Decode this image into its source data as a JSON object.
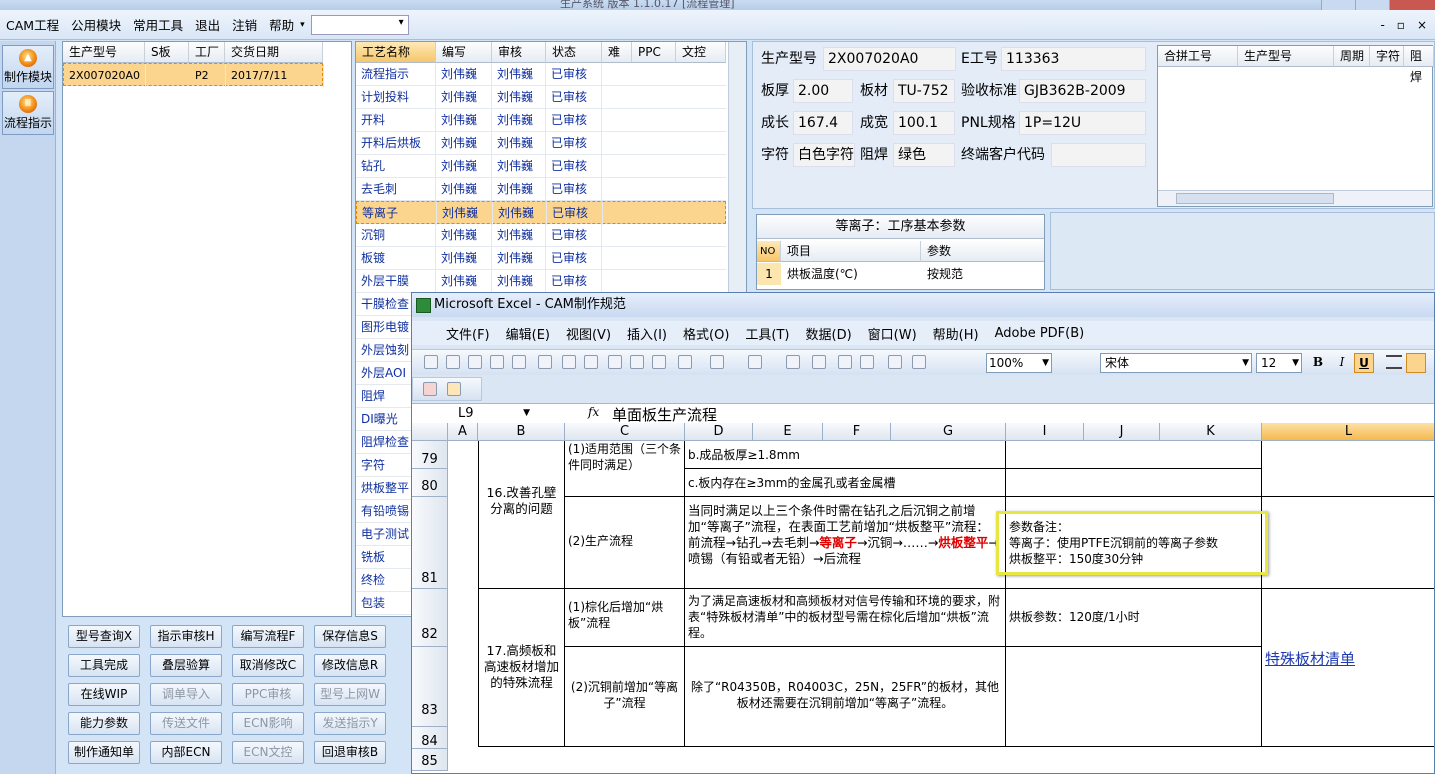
{
  "app": {
    "title": "生产系统  版本 1.1.0.17  [流程管理]"
  },
  "menubar": [
    "CAM工程",
    "公用模块",
    "常用工具",
    "退出",
    "注销",
    "帮助"
  ],
  "mdi_buttons": [
    "-",
    "▫",
    "×"
  ],
  "leftnav": [
    {
      "label": "制作模块",
      "icon": "fire-icon"
    },
    {
      "label": "流程指示",
      "icon": "flow-icon"
    }
  ],
  "jobs": {
    "headers": [
      "生产型号",
      "S板",
      "工厂",
      "交货日期"
    ],
    "rows": [
      [
        "2X007020A0",
        "",
        "P2",
        "2017/7/11"
      ]
    ]
  },
  "process": {
    "headers": [
      "工艺名称",
      "编写",
      "审核",
      "状态",
      "难",
      "PPC",
      "文控"
    ],
    "selected": 6,
    "rows": [
      [
        "流程指示",
        "刘伟巍",
        "刘伟巍",
        "已审核"
      ],
      [
        "计划投料",
        "刘伟巍",
        "刘伟巍",
        "已审核"
      ],
      [
        "开料",
        "刘伟巍",
        "刘伟巍",
        "已审核"
      ],
      [
        "开料后烘板",
        "刘伟巍",
        "刘伟巍",
        "已审核"
      ],
      [
        "钻孔",
        "刘伟巍",
        "刘伟巍",
        "已审核"
      ],
      [
        "去毛刺",
        "刘伟巍",
        "刘伟巍",
        "已审核"
      ],
      [
        "等离子",
        "刘伟巍",
        "刘伟巍",
        "已审核"
      ],
      [
        "沉铜",
        "刘伟巍",
        "刘伟巍",
        "已审核"
      ],
      [
        "板镀",
        "刘伟巍",
        "刘伟巍",
        "已审核"
      ],
      [
        "外层干膜",
        "刘伟巍",
        "刘伟巍",
        "已审核"
      ],
      [
        "干膜检查"
      ],
      [
        "图形电镀"
      ],
      [
        "外层蚀刻"
      ],
      [
        "外层AOI"
      ],
      [
        "阻焊"
      ],
      [
        "DI曝光"
      ],
      [
        "阻焊检查"
      ],
      [
        "字符"
      ],
      [
        "烘板整平"
      ],
      [
        "有铅喷锡"
      ],
      [
        "电子测试"
      ],
      [
        "铣板"
      ],
      [
        "终检"
      ],
      [
        "包装"
      ]
    ]
  },
  "buttons": [
    {
      "label": "型号查询X",
      "enabled": true
    },
    {
      "label": "指示审核H",
      "enabled": true
    },
    {
      "label": "编写流程F",
      "enabled": true
    },
    {
      "label": "保存信息S",
      "enabled": true
    },
    {
      "label": "工具完成",
      "enabled": true
    },
    {
      "label": "叠层验算",
      "enabled": true
    },
    {
      "label": "取消修改C",
      "enabled": true
    },
    {
      "label": "修改信息R",
      "enabled": true
    },
    {
      "label": "在线WIP",
      "enabled": true
    },
    {
      "label": "调单导入",
      "enabled": false
    },
    {
      "label": "PPC审核",
      "enabled": false
    },
    {
      "label": "型号上网W",
      "enabled": false
    },
    {
      "label": "能力参数",
      "enabled": true
    },
    {
      "label": "传送文件",
      "enabled": false
    },
    {
      "label": "ECN影响",
      "enabled": false
    },
    {
      "label": "发送指示Y",
      "enabled": false
    },
    {
      "label": "制作通知单",
      "enabled": true
    },
    {
      "label": "内部ECN",
      "enabled": true
    },
    {
      "label": "ECN文控",
      "enabled": false
    },
    {
      "label": "回退审核B",
      "enabled": true
    }
  ],
  "info": {
    "model_label": "生产型号",
    "model": "2X007020A0",
    "eno_label": "E工号",
    "eno": "113363",
    "thick_label": "板厚",
    "thick": "2.00",
    "mat_label": "板材",
    "mat": "TU-752",
    "std_label": "验收标准",
    "std": "GJB362B-2009",
    "len_label": "成长",
    "len": "167.4",
    "wid_label": "成宽",
    "wid": "100.1",
    "pnl_label": "PNL规格",
    "pnl": "1P=12U",
    "char_label": "字符",
    "char": "白色字符",
    "mask_label": "阻焊",
    "mask": "绿色",
    "cust_label": "终端客户代码",
    "cust": ""
  },
  "merge_headers": [
    "合拼工号",
    "生产型号",
    "周期",
    "字符",
    "阻焊"
  ],
  "params": {
    "title": "等离子：工序基本参数",
    "headers": [
      "NO",
      "项目",
      "参数"
    ],
    "rows": [
      [
        "1",
        "烘板温度(℃)",
        "按规范"
      ]
    ]
  },
  "excel": {
    "title": "Microsoft Excel - CAM制作规范",
    "menu": [
      "文件(F)",
      "编辑(E)",
      "视图(V)",
      "插入(I)",
      "格式(O)",
      "工具(T)",
      "数据(D)",
      "窗口(W)",
      "帮助(H)",
      "Adobe PDF(B)"
    ],
    "zoom": "100%",
    "font": "宋体",
    "size": "12",
    "namebox": "L9",
    "formula": "单面板生产流程",
    "columns": [
      "A",
      "B",
      "C",
      "D",
      "E",
      "F",
      "G",
      "I",
      "J",
      "K",
      "L"
    ],
    "rows": [
      "79",
      "80",
      "81",
      "82",
      "83",
      "84",
      "85"
    ],
    "b16": "16.改善孔壁分离的问题",
    "c79": "(1)适用范围（三个条件同时满足）",
    "d79": "b.成品板厚≥1.8mm",
    "d80": "c.板内存在≥3mm的金属孔或者金属槽",
    "c81": "(2)生产流程",
    "d81a": "当同时满足以上三个条件时需在钻孔之后沉铜之前增加“等离子”流程，在表面工艺前增加“烘板整平”流程：",
    "d81b": "前流程→钻孔→去毛刺→",
    "d81c": "等离子",
    "d81d": "→沉铜→……→",
    "d81e": "烘板整平",
    "d81f": "→喷锡（有铅或者无铅）→后流程",
    "i81": "参数备注：\n等离子：使用PTFE沉铜前的等离子参数\n烘板整平：150度30分钟",
    "b17": "17.高频板和高速板材增加的特殊流程",
    "c82": "(1)棕化后增加“烘板”流程",
    "d82": "为了满足高速板材和高频板材对信号传输和环境的要求，附表“特殊板材清单”中的板材型号需在棕化后增加“烘板”流程。",
    "i82": "烘板参数：120度/1小时",
    "c83": "(2)沉铜前增加“等离子”流程",
    "d83": "除了“R04350B，R04003C，25N，25FR”的板材，其他板材还需要在沉铜前增加“等离子”流程。",
    "l83": "特殊板材清单"
  }
}
